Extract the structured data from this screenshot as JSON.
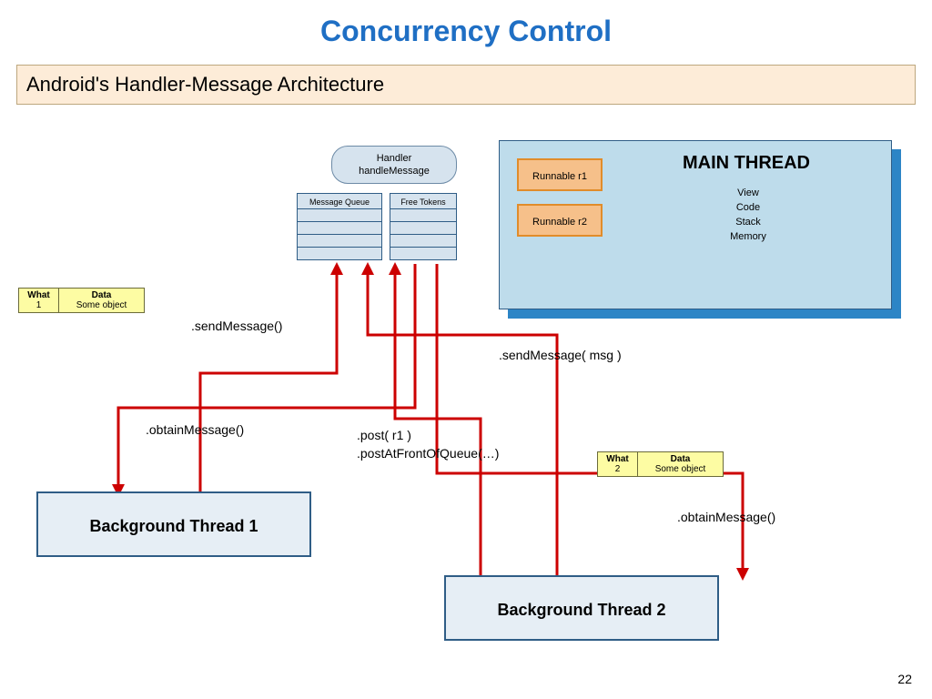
{
  "title": "Concurrency Control",
  "subtitle": "Android's   Handler-Message  Architecture",
  "handler": {
    "line1": "Handler",
    "line2": "handleMessage"
  },
  "queues": {
    "mq": "Message Queue",
    "ft": "Free Tokens"
  },
  "main": {
    "heading": "MAIN THREAD",
    "stack": [
      "View",
      "Code",
      "Stack",
      "Memory"
    ],
    "runnables": {
      "r1": "Runnable  r1",
      "r2": "Runnable  r2"
    }
  },
  "msg1": {
    "h1": "What",
    "h2": "Data",
    "v1": "1",
    "v2": "Some object"
  },
  "msg2": {
    "h1": "What",
    "h2": "Data",
    "v1": "2",
    "v2": "Some object"
  },
  "threads": {
    "bg1": "Background Thread 1",
    "bg2": "Background Thread 2"
  },
  "labels": {
    "sendMessage1": ".sendMessage()",
    "obtainMessage1": ".obtainMessage()",
    "sendMessageMsg": ".sendMessage( msg )",
    "post1": ".post( r1 )",
    "post2": ".postAtFrontOfQueue(…)",
    "obtainMessage2": ".obtainMessage()"
  },
  "page": "22"
}
